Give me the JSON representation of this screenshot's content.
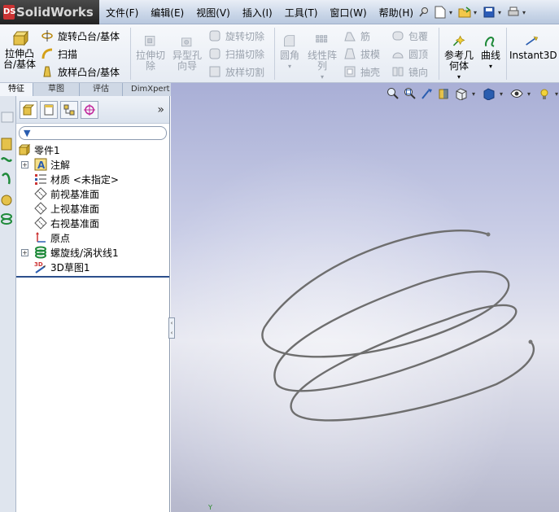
{
  "app": {
    "logo_text": "SolidWorks",
    "logo_badge": "DS"
  },
  "menu": [
    "文件(F)",
    "编辑(E)",
    "视图(V)",
    "插入(I)",
    "工具(T)",
    "窗口(W)",
    "帮助(H)"
  ],
  "quick_access": {
    "icons": [
      "pin-icon",
      "new-document-icon",
      "open-folder-icon",
      "save-icon",
      "print-icon"
    ]
  },
  "ribbon": {
    "extrude_boss": "拉伸凸\n台/基体",
    "revolve_boss": "旋转凸台/基体",
    "sweep": "扫描",
    "loft_boss": "放样凸台/基体",
    "extrude_cut": "拉伸切\n除",
    "hole_wizard": "异型孔\n向导",
    "revolve_cut": "旋转切除",
    "sweep_cut": "扫描切除",
    "loft_cut": "放样切割",
    "fillet": "圆角",
    "linear_pattern": "线性阵\n列",
    "rib": "筋",
    "draft": "拔模",
    "shell": "抽壳",
    "wrap": "包覆",
    "dome": "圆顶",
    "mirror": "镜向",
    "ref_geometry": "参考几\n何体",
    "curves": "曲线",
    "instant3d": "Instant3D"
  },
  "tabs": [
    "特征",
    "草图",
    "评估",
    "DimXpert"
  ],
  "tree": {
    "root": "零件1",
    "items": [
      {
        "label": "注解",
        "expandable": true
      },
      {
        "label": "材质 <未指定>",
        "expandable": false
      },
      {
        "label": "前视基准面",
        "expandable": false
      },
      {
        "label": "上视基准面",
        "expandable": false
      },
      {
        "label": "右视基准面",
        "expandable": false
      },
      {
        "label": "原点",
        "expandable": false
      },
      {
        "label": "螺旋线/涡状线1",
        "expandable": true
      },
      {
        "label": "3D草图1",
        "expandable": false
      }
    ]
  },
  "colors": {
    "accent": "#2c4f8c",
    "helix": "#6e6e6e",
    "viewport_top": "#a9afd6"
  }
}
